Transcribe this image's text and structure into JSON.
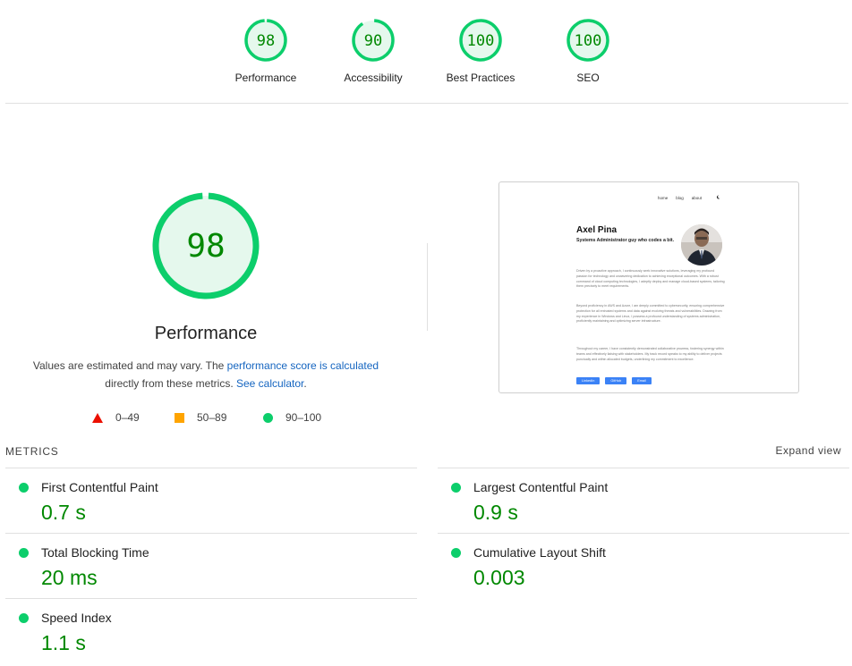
{
  "categories": [
    {
      "score": "98",
      "label": "Performance",
      "fraction": 0.98
    },
    {
      "score": "90",
      "label": "Accessibility",
      "fraction": 0.9
    },
    {
      "score": "100",
      "label": "Best Practices",
      "fraction": 1.0
    },
    {
      "score": "100",
      "label": "SEO",
      "fraction": 1.0
    }
  ],
  "performance": {
    "score": "98",
    "fraction": 0.98,
    "title": "Performance",
    "desc_prefix": "Values are estimated and may vary. The ",
    "desc_link1": "performance score is calculated",
    "desc_middle": " directly from these metrics. ",
    "desc_link2": "See calculator",
    "desc_suffix": "."
  },
  "legend": {
    "fail": "0–49",
    "average": "50–89",
    "pass": "90–100"
  },
  "preview": {
    "nav": [
      "home",
      "blog",
      "about"
    ],
    "name": "Axel Pina",
    "tagline": "Systems Administrator guy who codes a bit.",
    "para1": "Driven by a proactive approach, I continuously seek innovative solutions, leveraging my profound passion for technology and unwavering dedication to achieving exceptional outcomes. With a robust command of cloud computing technologies, I adeptly deploy and manage cloud-based systems, tailoring them precisely to meet requirements.",
    "para2": "Beyond proficiency in AWS and Azure, I am deeply committed to cybersecurity, ensuring comprehensive protection for all entrusted systems and data against evolving threats and vulnerabilities. Drawing from my experience in Windows and Linux, I possess a profound understanding of systems administration, proficiently maintaining and optimizing server infrastructure.",
    "para3": "Throughout my career, I have consistently demonstrated collaborative prowess, fostering synergy within teams and effectively liaising with stakeholders. My track record speaks to my ability to deliver projects punctually and within allocated budgets, underlining my commitment to excellence.",
    "buttons": [
      "LinkedIn",
      "GitHub",
      "Email"
    ]
  },
  "metrics": {
    "header": "METRICS",
    "expand": "Expand view",
    "items": [
      {
        "name": "First Contentful Paint",
        "value": "0.7 s"
      },
      {
        "name": "Largest Contentful Paint",
        "value": "0.9 s"
      },
      {
        "name": "Total Blocking Time",
        "value": "20 ms"
      },
      {
        "name": "Cumulative Layout Shift",
        "value": "0.003"
      },
      {
        "name": "Speed Index",
        "value": "1.1 s"
      }
    ]
  },
  "colors": {
    "pass": "#0cce6b",
    "pass_text": "#008800",
    "pass_bg": "#e5f8ed",
    "average": "#ffa400",
    "fail": "#eb0f00",
    "link": "#1565c0"
  }
}
